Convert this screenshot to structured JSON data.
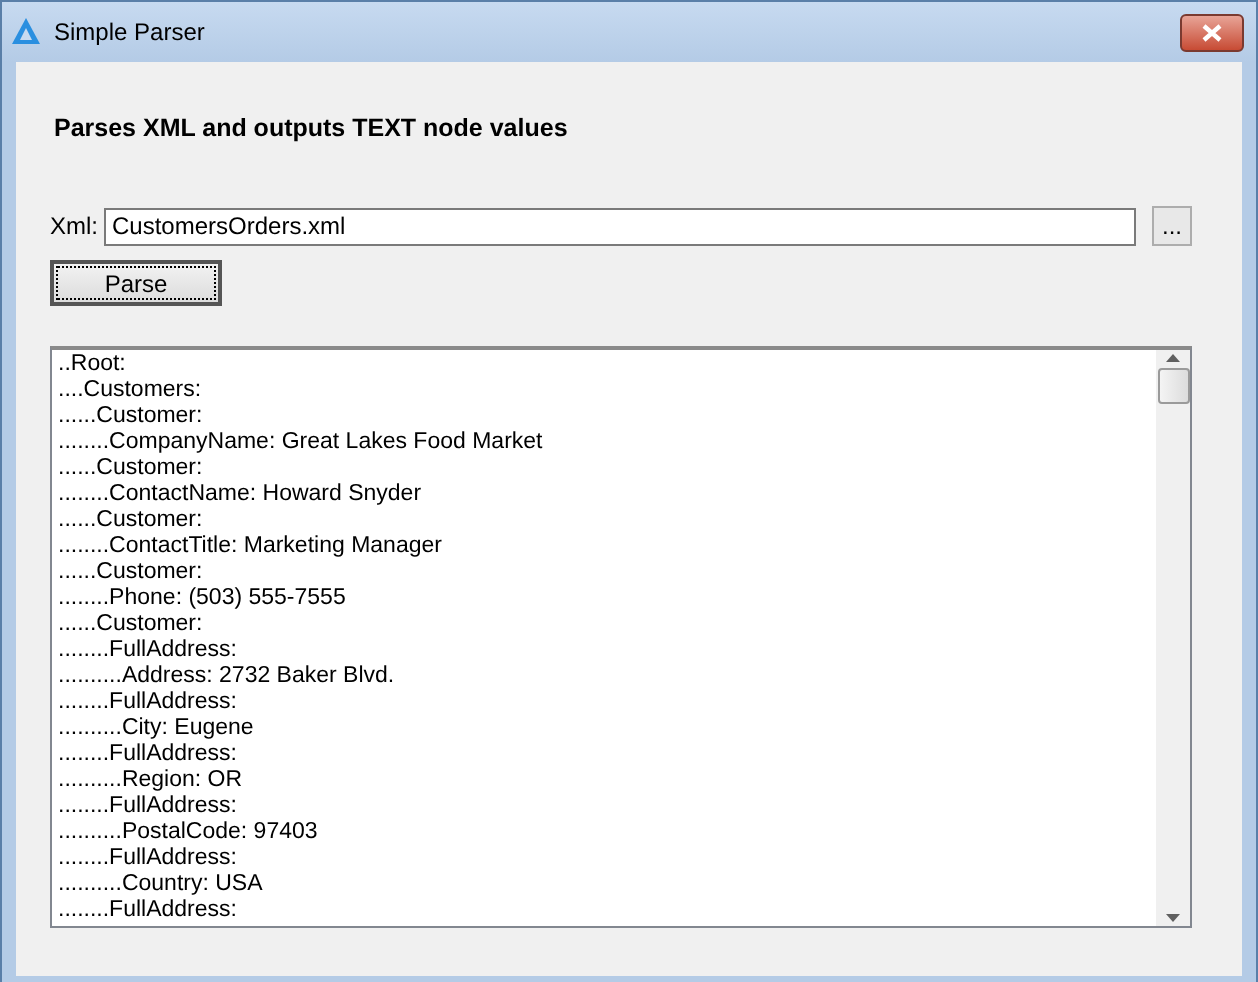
{
  "window": {
    "title": "Simple Parser"
  },
  "heading": "Parses XML and outputs TEXT node values",
  "xml_field": {
    "label": "Xml:",
    "value": "CustomersOrders.xml"
  },
  "browse_button": "...",
  "parse_button": "Parse",
  "output_lines": [
    "..Root:",
    "....Customers:",
    "......Customer:",
    "........CompanyName: Great Lakes Food Market",
    "......Customer:",
    "........ContactName: Howard Snyder",
    "......Customer:",
    "........ContactTitle: Marketing Manager",
    "......Customer:",
    "........Phone: (503) 555-7555",
    "......Customer:",
    "........FullAddress:",
    "..........Address: 2732 Baker Blvd.",
    "........FullAddress:",
    "..........City: Eugene",
    "........FullAddress:",
    "..........Region: OR",
    "........FullAddress:",
    "..........PostalCode: 97403",
    "........FullAddress:",
    "..........Country: USA",
    "........FullAddress:"
  ]
}
